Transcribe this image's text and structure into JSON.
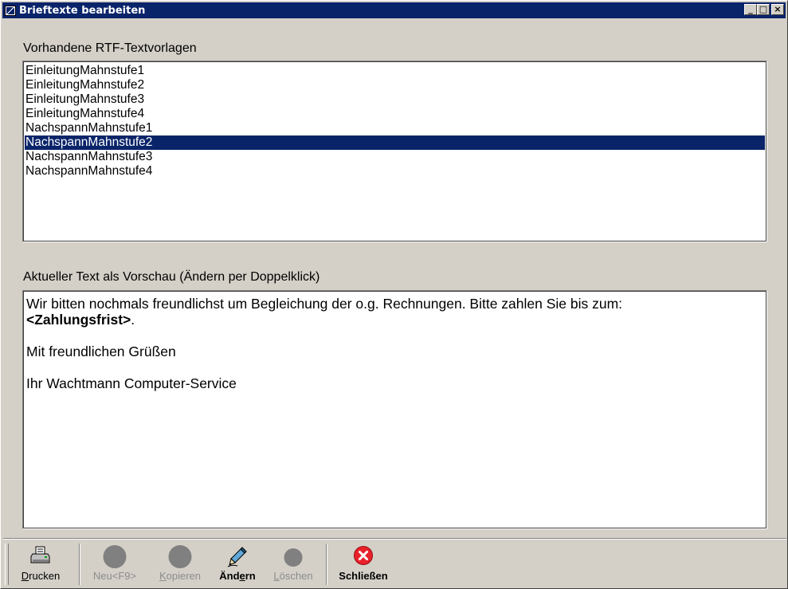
{
  "window": {
    "title": "Brieftexte bearbeiten",
    "controls": {
      "minimize": "_",
      "maximize": "□",
      "close": "×"
    }
  },
  "templates": {
    "label": "Vorhandene RTF-Textvorlagen",
    "items": [
      "EinleitungMahnstufe1",
      "EinleitungMahnstufe2",
      "EinleitungMahnstufe3",
      "EinleitungMahnstufe4",
      "NachspannMahnstufe1",
      "NachspannMahnstufe2",
      "NachspannMahnstufe3",
      "NachspannMahnstufe4"
    ],
    "selected": "NachspannMahnstufe2"
  },
  "preview": {
    "label": "Aktueller Text als Vorschau (Ändern per Doppelklick)",
    "line1": "Wir bitten nochmals freundlichst um Begleichung der o.g. Rechnungen. Bitte zahlen Sie bis zum:",
    "placeholder": "<Zahlungsfrist>",
    "line2_suffix": ".",
    "greeting": "Mit freundlichen Grüßen",
    "signature": "Ihr Wachtmann Computer-Service"
  },
  "toolbar": {
    "print": {
      "accel": "D",
      "rest": "rucken"
    },
    "new": {
      "label": "Neu<F9>"
    },
    "copy": {
      "accel": "K",
      "rest": "opieren"
    },
    "edit": {
      "pre": "Änd",
      "accel": "e",
      "post": "rn"
    },
    "delete": {
      "accel": "L",
      "rest": "öschen"
    },
    "close": {
      "label": "Schließen"
    }
  },
  "colors": {
    "title_bar": "#0a246a",
    "selection": "#0a246a",
    "window_face": "#d4d0c8",
    "close_icon": "#e8212a"
  }
}
